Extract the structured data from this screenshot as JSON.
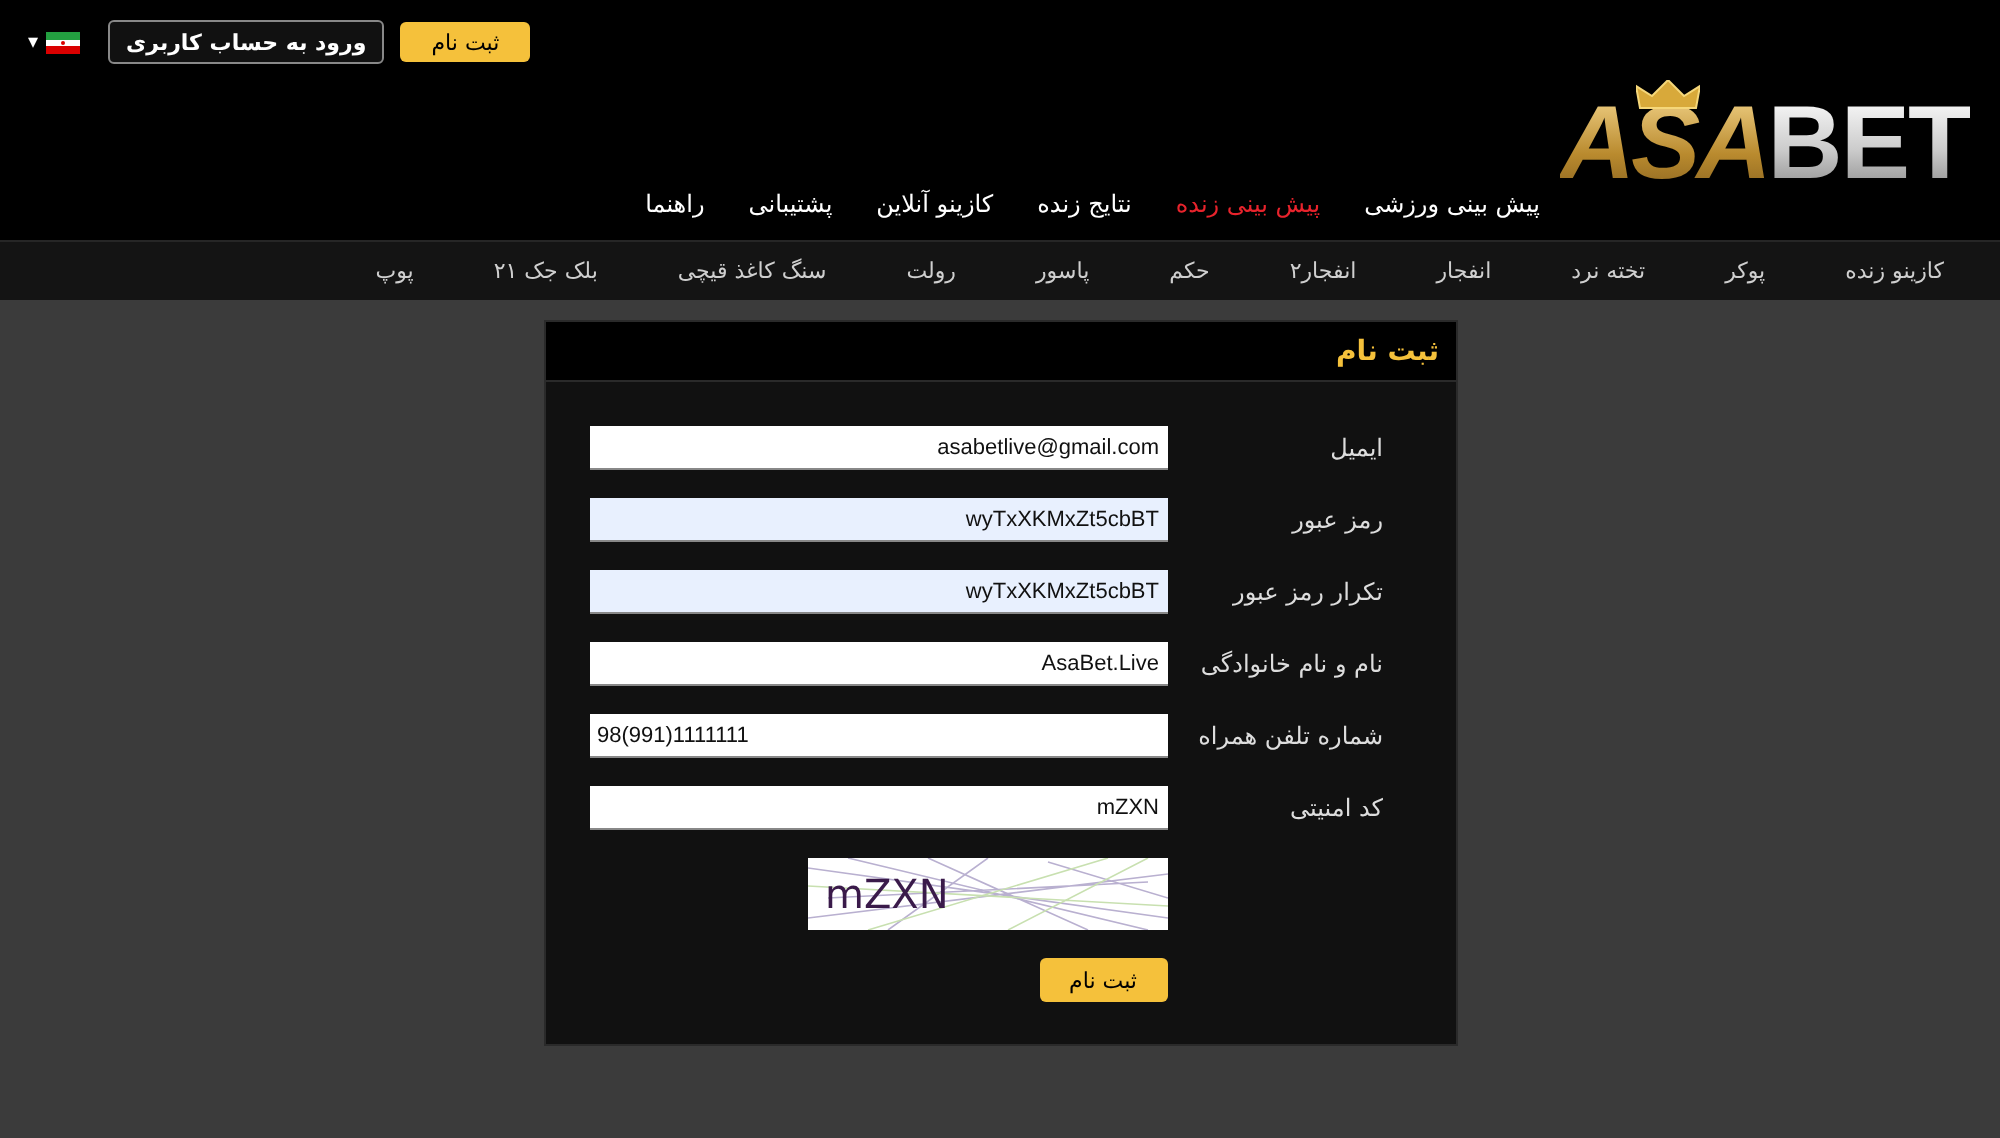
{
  "header": {
    "register_button": "ثبت نام",
    "login_button": "ورود به حساب کاربری",
    "language": {
      "caret": "▾"
    },
    "logo": {
      "gold": "ASA",
      "silver": "BET"
    }
  },
  "main_nav": [
    {
      "label": "پیش بینی ورزشی",
      "selected": false
    },
    {
      "label": "پیش بینی زنده",
      "selected": true
    },
    {
      "label": "نتایج زنده",
      "selected": false
    },
    {
      "label": "کازینو آنلاین",
      "selected": false
    },
    {
      "label": "پشتیبانی",
      "selected": false
    },
    {
      "label": "راهنما",
      "selected": false
    }
  ],
  "sub_nav": [
    "کازینو زنده",
    "پوکر",
    "تخته نرد",
    "انفجار",
    "انفجار۲",
    "حکم",
    "پاسور",
    "رولت",
    "سنگ کاغذ قیچی",
    "بلک جک ۲۱",
    "پوپ"
  ],
  "form": {
    "title": "ثبت نام",
    "fields": [
      {
        "label": "ایمیل",
        "value": "asabetlive@gmail.com",
        "autofilled": false,
        "ltr": false
      },
      {
        "label": "رمز عبور",
        "value": "wyTxXKMxZt5cbBT",
        "autofilled": true,
        "ltr": false
      },
      {
        "label": "تکرار رمز عبور",
        "value": "wyTxXKMxZt5cbBT",
        "autofilled": true,
        "ltr": false
      },
      {
        "label": "نام و نام خانوادگی",
        "value": "AsaBet.Live",
        "autofilled": false,
        "ltr": false
      },
      {
        "label": "شماره تلفن همراه",
        "value": "98(991)1111111",
        "autofilled": false,
        "ltr": true
      },
      {
        "label": "کد امنیتی",
        "value": "mZXN",
        "autofilled": false,
        "ltr": false
      }
    ],
    "captcha": "mZXN",
    "submit": "ثبت نام"
  }
}
